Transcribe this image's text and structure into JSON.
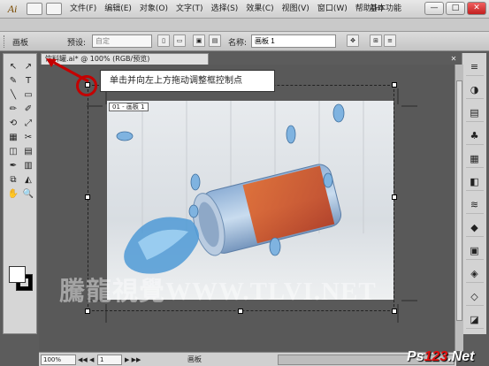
{
  "app": {
    "logo": "Ai",
    "workspace": "基本功能",
    "window_buttons": [
      "—",
      "□",
      "✕"
    ]
  },
  "menu": [
    "文件(F)",
    "编辑(E)",
    "对象(O)",
    "文字(T)",
    "选择(S)",
    "效果(C)",
    "视图(V)",
    "窗口(W)",
    "帮助(H)"
  ],
  "control_bar": {
    "label": "画板",
    "preset_label": "预设:",
    "preset_value": "自定",
    "name_label": "名称:",
    "name_value": "画板 1"
  },
  "document": {
    "tab_title": "饮料罐.ai* @ 100% (RGB/预览)",
    "close": "✕",
    "artboard_label": "01 - 画板 1"
  },
  "annotation": {
    "text": "单击并向左上方拖动调整框控制点"
  },
  "tools": [
    "↖",
    "↗",
    "✎",
    "T",
    "╲",
    "▭",
    "✏",
    "✐",
    "⟲",
    "⤢",
    "▦",
    "✂",
    "◫",
    "▤",
    "✒",
    "▥",
    "⧉",
    "◭",
    "✋",
    "🔍"
  ],
  "swatches": {
    "fill": "#ffffff",
    "stroke": "#000000"
  },
  "panel_icons": [
    "≡",
    "◑",
    "▤",
    "♣",
    "▦",
    "◧",
    "≋",
    "◆",
    "▣",
    "◈",
    "◇",
    "◪"
  ],
  "status": {
    "zoom": "100%",
    "page": "1",
    "mode": "画板",
    "nav_prev": "◀◀ ◀",
    "nav_next": "▶ ▶▶"
  },
  "watermark": "騰龍視覺WWW.TLVI.NET",
  "brand": {
    "prefix": "Ps",
    "number": "123",
    "suffix": ".Net"
  }
}
